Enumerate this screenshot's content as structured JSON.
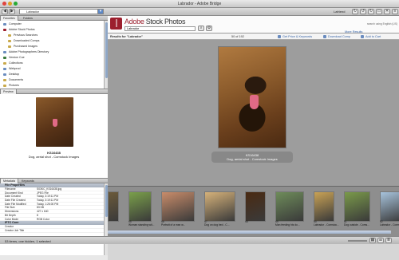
{
  "window": {
    "title": "Labrador - Adobe Bridge"
  },
  "toolbar": {
    "path": "Labrador",
    "workspace": "Lafriend"
  },
  "left_tabs": [
    "Favorites",
    "Folders"
  ],
  "favorites": [
    {
      "label": "Computer",
      "indent": false,
      "color": "#6a8cbf"
    },
    {
      "label": "Adobe Stock Photos",
      "indent": false,
      "color": "#9c1f2d"
    },
    {
      "label": "Previous Searches",
      "indent": true,
      "color": "#c9a94a"
    },
    {
      "label": "Downloaded Comps",
      "indent": true,
      "color": "#c9a94a"
    },
    {
      "label": "Purchased Images",
      "indent": true,
      "color": "#c9a94a"
    },
    {
      "label": "Adobe Photographers Directory",
      "indent": false,
      "color": "#6a8cbf"
    },
    {
      "label": "Version Cue",
      "indent": false,
      "color": "#3b7a3b"
    },
    {
      "label": "Collections",
      "indent": false,
      "color": "#c9a94a"
    },
    {
      "label": "Webprod",
      "indent": false,
      "color": "#6a8cbf"
    },
    {
      "label": "Desktop",
      "indent": false,
      "color": "#6a8cbf"
    },
    {
      "label": "Documents",
      "indent": false,
      "color": "#c9a94a"
    },
    {
      "label": "Pictures",
      "indent": false,
      "color": "#c9a94a"
    }
  ],
  "preview": {
    "tab": "Preview",
    "code": "KS16438",
    "caption": "Dog, aerial shot - Comstock Images"
  },
  "meta_tabs": [
    "Metadata",
    "Keywords"
  ],
  "file_properties": {
    "header": "File Properties",
    "rows": [
      {
        "k": "Filename",
        "v": "S03KC_KS16438.jpg"
      },
      {
        "k": "Document Kind",
        "v": "JPEG File"
      },
      {
        "k": "Date Created",
        "v": "Today, 3:19:11 PM"
      },
      {
        "k": "Date File Created",
        "v": "Today, 3:19:11 PM"
      },
      {
        "k": "Date File Modified",
        "v": "Today, 1:26:00 PM"
      },
      {
        "k": "File Size",
        "v": "83 KB"
      },
      {
        "k": "Dimensions",
        "v": "427 x 640"
      },
      {
        "k": "Bit Depth",
        "v": "8"
      },
      {
        "k": "Color Mode",
        "v": "RGB Color"
      }
    ]
  },
  "iptc": {
    "header": "IPTC Core",
    "rows": [
      {
        "k": "Creator",
        "v": ""
      },
      {
        "k": "Creator Job Title",
        "v": ""
      }
    ]
  },
  "status": "53 items, one hidden, 1 selected",
  "stock": {
    "brand_a": "Adobe",
    "brand_b": "Stock Photos",
    "search_value": "Labrador",
    "sub_text": "search using English (US)"
  },
  "results": {
    "label": "Results for \"Labrador\"",
    "count": "50 of 192",
    "more": "More Results"
  },
  "actions": [
    "Get Price & Keywords",
    "Download Comp",
    "Add to Cart"
  ],
  "main_caption": {
    "code": "KS16438",
    "text": "Dog, aerial shot - Comstock Images"
  },
  "thumbs": [
    {
      "num": "",
      "label": "",
      "color": "#6b5a3a"
    },
    {
      "num": "45",
      "label": "Woman standing wit...",
      "color": "#7aa04a"
    },
    {
      "num": "46",
      "label": "Portrait of a man w...",
      "color": "#c98c6a"
    },
    {
      "num": "47",
      "label": "Dog on dog bed - C...",
      "color": "#d6b27a"
    },
    {
      "num": "48",
      "label": "",
      "color": "#4a2a12"
    },
    {
      "num": "49",
      "label": "Man feeding his do...",
      "color": "#6e8c5a"
    },
    {
      "num": "50",
      "label": "Labrador - Comstoc...",
      "color": "#c9a255"
    },
    {
      "num": "51",
      "label": "Dog outside - Coms...",
      "color": "#7a9a4a"
    },
    {
      "num": "52",
      "label": "Labrador - Comstoc...",
      "color": "#a7c3dc"
    }
  ]
}
